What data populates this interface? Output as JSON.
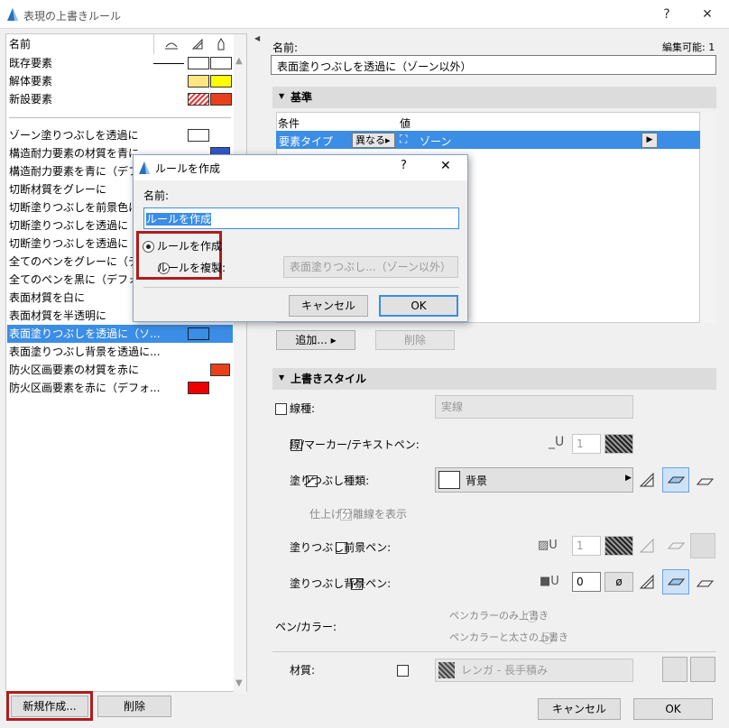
{
  "window": {
    "title": "表現の上書きルール",
    "help": "?",
    "close": "✕"
  },
  "left": {
    "header_name": "名前",
    "states": [
      {
        "label": "既存要素"
      },
      {
        "label": "解体要素"
      },
      {
        "label": "新設要素"
      }
    ],
    "rules": [
      "ゾーン塗りつぶしを透過に",
      "構造耐力要素の材質を青に",
      "構造耐力要素を青に（デフォ",
      "切断材質をグレーに",
      "切断塗りつぶしを前景色に",
      "切断塗りつぶしを透過に（分",
      "切断塗りつぶしを透過に（分",
      "全てのペンをグレーに（デフォ",
      "全てのペンを黒に（デフォルト",
      "表面材質を白に",
      "表面材質を半透明に",
      "表面塗りつぶしを透過に（ソ...",
      "表面塗りつぶし背景を透過に...",
      "防火区画要素の材質を赤に",
      "防火区画要素を赤に（デフォ..."
    ],
    "new_button": "新規作成...",
    "delete_button": "削除"
  },
  "right": {
    "name_label": "名前:",
    "editable_label": "編集可能: 1",
    "name_value": "表面塗りつぶしを透過に（ゾーン以外）",
    "criteria_section": "基準",
    "col_condition": "条件",
    "col_value": "値",
    "row_condition": "要素タイプ",
    "row_operator": "異なる",
    "row_value": "ゾーン",
    "add_button": "追加...",
    "remove_button": "削除",
    "style_section": "上書きスタイル",
    "line_type_label": "線種:",
    "line_type_value": "実線",
    "line_pen_label": "線/マーカー/テキストペン:",
    "line_pen_value": "1",
    "fill_type_label": "塗りつぶし種類:",
    "fill_type_value": "背景",
    "finish_line_label": "仕上げ分離線を表示",
    "fill_fg_label": "塗りつぶし前景ペン:",
    "fill_fg_value": "1",
    "fill_bg_label": "塗りつぶし背景ペン:",
    "fill_bg_value": "0",
    "pen_color_label": "ペン/カラー:",
    "pen_opt1": "ペンカラーのみ上書き",
    "pen_opt2": "ペンカラーと太さの上書き",
    "material_label": "材質:",
    "material_value": "レンガ - 長手積み",
    "cancel": "キャンセル",
    "ok": "OK"
  },
  "dialog": {
    "title": "ルールを作成",
    "help": "?",
    "close": "✕",
    "name_label": "名前:",
    "name_value": "ルールを作成",
    "opt_create": "ルールを作成",
    "opt_duplicate": "ルールを複製:",
    "duplicate_source": "表面塗りつぶし...（ゾーン以外）",
    "cancel": "キャンセル",
    "ok": "OK"
  },
  "colors": {
    "selection": "#3b8de5",
    "highlight": "#b01c1c"
  }
}
